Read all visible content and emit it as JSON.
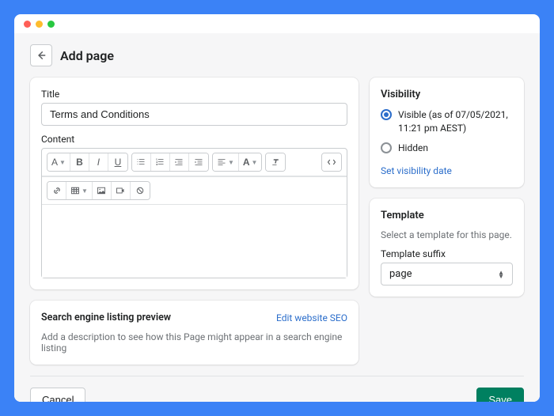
{
  "header": {
    "page_title": "Add page"
  },
  "main": {
    "title_label": "Title",
    "title_value": "Terms and Conditions",
    "content_label": "Content",
    "font_dropdown": "A"
  },
  "seo": {
    "heading": "Search engine listing preview",
    "edit_link": "Edit website SEO",
    "description": "Add a description to see how this Page might appear in a search engine listing"
  },
  "visibility": {
    "heading": "Visibility",
    "visible_label": "Visible (as of 07/05/2021, 11:21 pm AEST)",
    "hidden_label": "Hidden",
    "set_date_link": "Set visibility date"
  },
  "template": {
    "heading": "Template",
    "description": "Select a template for this page.",
    "suffix_label": "Template suffix",
    "suffix_value": "page"
  },
  "footer": {
    "cancel": "Cancel",
    "save": "Save"
  }
}
